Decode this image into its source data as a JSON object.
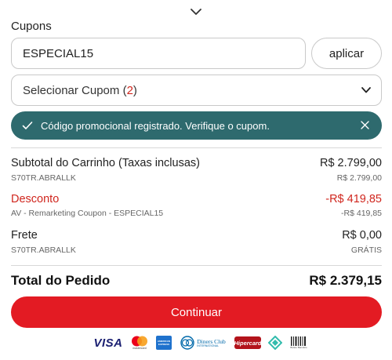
{
  "coupons": {
    "label": "Cupons",
    "input_value": "ESPECIAL15",
    "apply_label": "aplicar",
    "select_label": "Selecionar Cupom (",
    "select_count": "2",
    "select_close": ")"
  },
  "toast": {
    "message": "Código promocional registrado. Verifique o cupom."
  },
  "summary": {
    "subtotal_label": "Subtotal do Carrinho (Taxas inclusas)",
    "subtotal_value": "R$ 2.799,00",
    "subtotal_sku": "S70TR.ABRALLK",
    "subtotal_sku_value": "R$ 2.799,00",
    "discount_label": "Desconto",
    "discount_value": "-R$ 419,85",
    "discount_desc": "AV - Remarketing Coupon - ESPECIAL15",
    "discount_desc_value": "-R$ 419,85",
    "shipping_label": "Frete",
    "shipping_value": "R$ 0,00",
    "shipping_sku": "S70TR.ABRALLK",
    "shipping_sku_value": "GRÁTIS",
    "total_label": "Total do Pedido",
    "total_value": "R$ 2.379,15"
  },
  "actions": {
    "continue_label": "Continuar"
  },
  "payment_methods": {
    "visa": "VISA",
    "mastercard": "mastercard",
    "amex": "AMERICAN EXPRESS",
    "diners": "Diners Club",
    "diners_sub": "INTERNATIONAL",
    "hipercard": "Hipercard",
    "boleto": "Boleto Bancário"
  },
  "colors": {
    "accent_red": "#e31b23",
    "toast_bg": "#2e6a6e",
    "discount_red": "#d0261e"
  }
}
